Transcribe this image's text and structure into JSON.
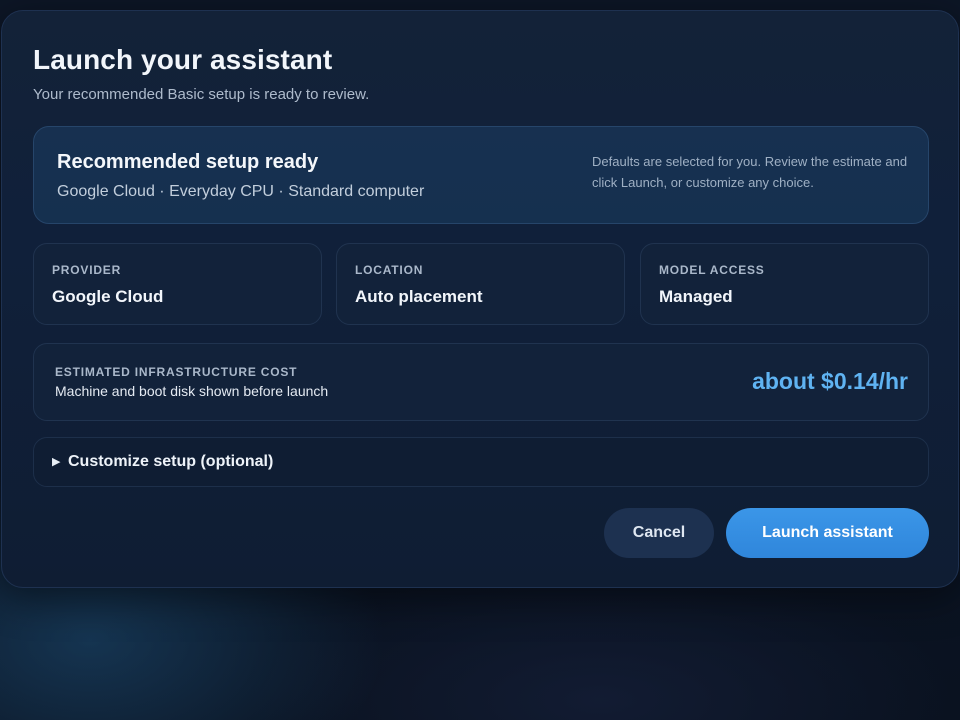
{
  "dialog": {
    "title": "Launch your assistant",
    "subtitle": "Your recommended Basic setup is ready to review."
  },
  "recommended": {
    "title": "Recommended setup ready",
    "summary": "Google Cloud · Everyday CPU · Standard computer",
    "note": "Defaults are selected for you. Review the estimate and click Launch, or customize any choice."
  },
  "info_cards": [
    {
      "label": "PROVIDER",
      "value": "Google Cloud"
    },
    {
      "label": "LOCATION",
      "value": "Auto placement"
    },
    {
      "label": "MODEL ACCESS",
      "value": "Managed"
    }
  ],
  "cost": {
    "label": "ESTIMATED INFRASTRUCTURE COST",
    "description": "Machine and boot disk shown before launch",
    "value": "about $0.14/hr"
  },
  "customize": {
    "arrow_icon": "triangle-right-icon",
    "label": "Customize setup (optional)"
  },
  "actions": {
    "cancel_label": "Cancel",
    "launch_label": "Launch assistant"
  },
  "colors": {
    "accent": "#2f86db",
    "cost_highlight": "#5fb3f2",
    "panel_bg": "#12223a"
  }
}
